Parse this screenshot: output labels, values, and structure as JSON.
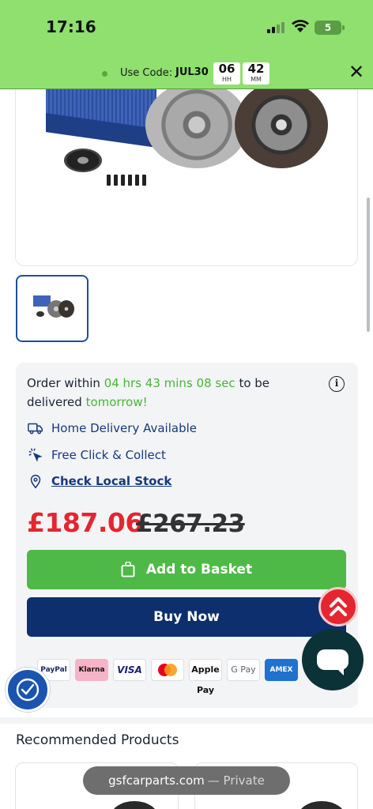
{
  "status_bar": {
    "time": "17:16",
    "battery": "5"
  },
  "promo": {
    "label": "Use Code:",
    "code": "JUL30",
    "hours": "06",
    "hours_unit": "HH",
    "minutes": "42",
    "minutes_unit": "MM",
    "close_icon": "close-icon"
  },
  "order": {
    "prefix": "Order within",
    "countdown": "04 hrs 43 mins 08 sec",
    "middle": "to be delivered",
    "day": "tomorrow!"
  },
  "features": [
    {
      "icon": "truck-icon",
      "label": "Home Delivery Available"
    },
    {
      "icon": "click-collect-icon",
      "label": "Free Click & Collect"
    },
    {
      "icon": "location-pin-icon",
      "label": "Check Local Stock"
    }
  ],
  "pricing": {
    "price": "£187.06",
    "was_price": "£267.23"
  },
  "buttons": {
    "add_to_basket": "Add to Basket",
    "buy_now": "Buy Now"
  },
  "payment_methods": [
    "PayPal",
    "Klarna",
    "VISA",
    "Mastercard",
    "Apple Pay",
    "G Pay",
    "AMEX"
  ],
  "recommended": {
    "title": "Recommended Products"
  },
  "browser": {
    "domain": "gsfcarparts.com",
    "mode": "— Private"
  },
  "colors": {
    "accent_green": "#4fb948",
    "navy": "#0e2f6e",
    "price_red": "#e5252f",
    "promo_bar": "#8fe06f"
  }
}
